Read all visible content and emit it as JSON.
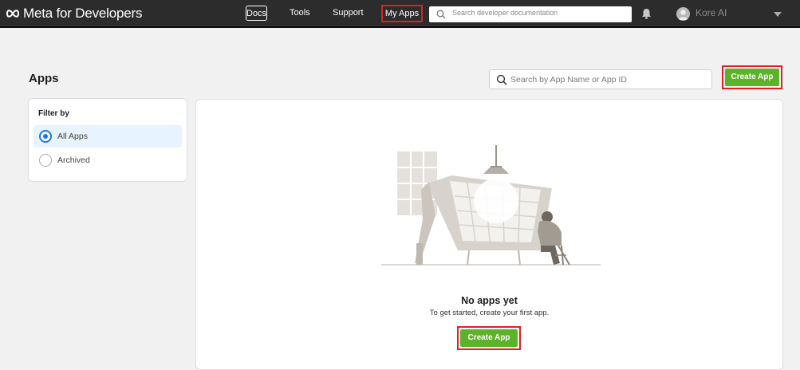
{
  "brand": {
    "name": "Meta for Developers"
  },
  "nav": {
    "docs": "Docs",
    "tools": "Tools",
    "support": "Support",
    "my_apps": "My Apps",
    "search_placeholder": "Search developer documentation"
  },
  "user": {
    "name": "Kore AI"
  },
  "page": {
    "title": "Apps",
    "search_placeholder": "Search by App Name or App ID",
    "create_button": "Create App"
  },
  "filter": {
    "title": "Filter by",
    "options": [
      {
        "label": "All Apps",
        "selected": true
      },
      {
        "label": "Archived",
        "selected": false
      }
    ]
  },
  "empty_state": {
    "title": "No apps yet",
    "subtitle": "To get started, create your first app.",
    "button": "Create App"
  },
  "colors": {
    "accent_green": "#5cb229",
    "highlight_red": "#e02020",
    "radio_blue": "#1877f2",
    "topbar": "#2c2c2c"
  }
}
